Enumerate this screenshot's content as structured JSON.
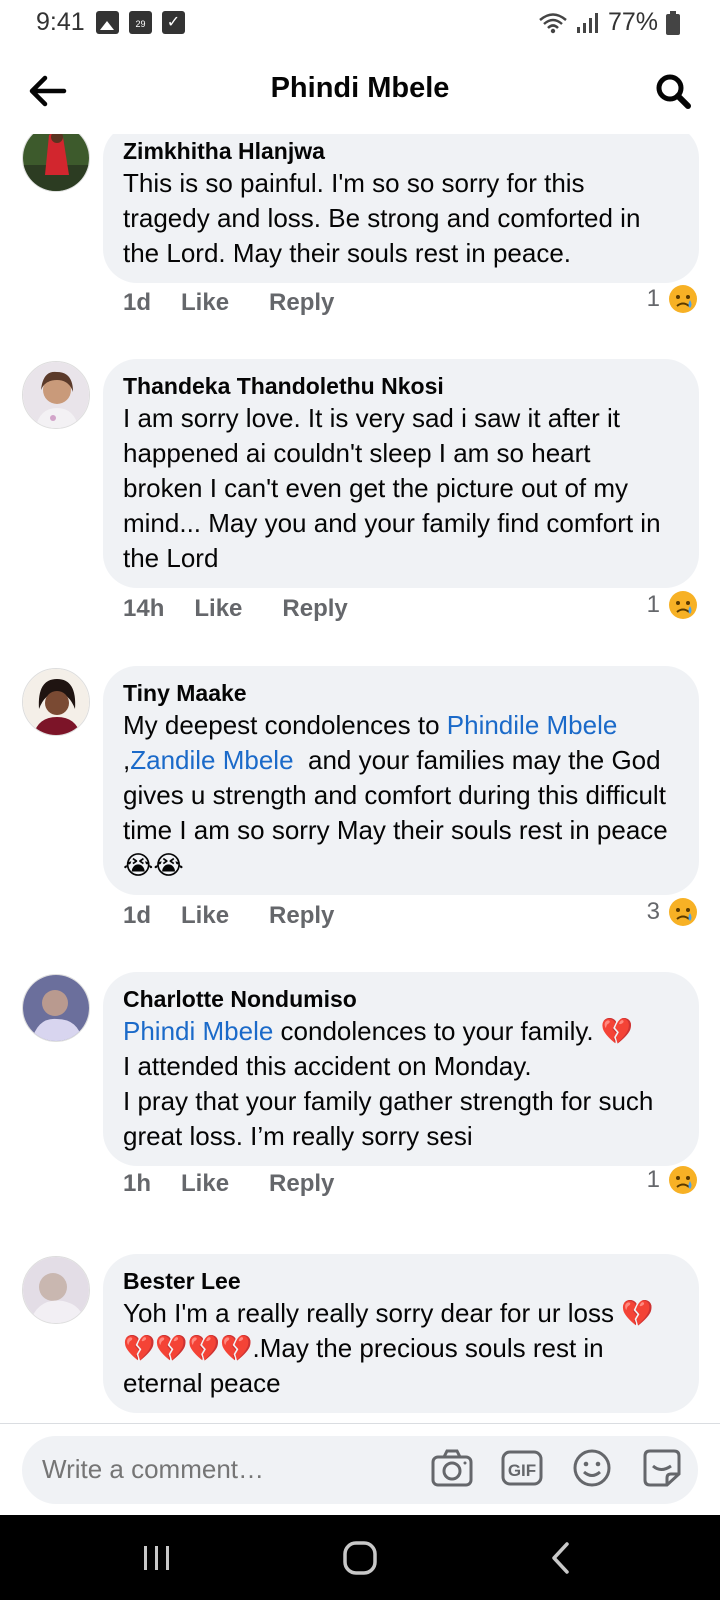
{
  "status": {
    "time": "9:41",
    "calendar_day": "29",
    "battery": "77%"
  },
  "header": {
    "title": "Phindi Mbele"
  },
  "comments": [
    {
      "author": "Zimkhitha Hlanjwa",
      "text": "This is so painful. I'm so so sorry for this tragedy and loss. Be strong and comforted in the Lord. May their souls rest in peace.",
      "time": "1d",
      "like": "Like",
      "reply": "Reply",
      "reaction_count": "1"
    },
    {
      "author": "Thandeka Thandolethu Nkosi",
      "text": "I am sorry love. It is very sad i saw it after it happened ai couldn't sleep I am so heart broken I can't even get the picture out of my mind... May you and your family find comfort in the Lord",
      "time": "14h",
      "like": "Like",
      "reply": "Reply",
      "reaction_count": "1"
    },
    {
      "author": "Tiny Maake",
      "text_before": "My deepest condolences to ",
      "mention_1": "Phindile Mbele",
      "text_between": " ,",
      "mention_2": "Zandile Mbele",
      "text_after": "  and your families may the God gives u strength and comfort during this difficult time I am so sorry May their souls rest in peace😭😭",
      "time": "1d",
      "like": "Like",
      "reply": "Reply",
      "reaction_count": "3"
    },
    {
      "author": "Charlotte Nondumiso",
      "mention": "Phindi Mbele",
      "text_after": " condolences to your family. 💔\nI attended this accident on Monday.\nI pray that your family gather strength for such great loss. I’m really sorry sesi",
      "time": "1h",
      "like": "Like",
      "reply": "Reply",
      "reaction_count": "1"
    },
    {
      "author": "Bester Lee",
      "text": "Yoh I'm a really really sorry dear for ur loss 💔💔💔💔💔.May the precious souls rest in eternal peace"
    }
  ],
  "composer": {
    "placeholder": "Write a comment…"
  },
  "icons": {
    "back": "arrow-left-icon",
    "search": "search-icon",
    "camera": "camera-icon",
    "gif": "gif-icon",
    "emoji": "emoji-icon",
    "sticker": "sticker-icon",
    "reaction": "sad-reaction-icon"
  },
  "colors": {
    "mention": "#1b6ac9",
    "bubble": "#f0f2f5",
    "meta": "#65676b"
  }
}
